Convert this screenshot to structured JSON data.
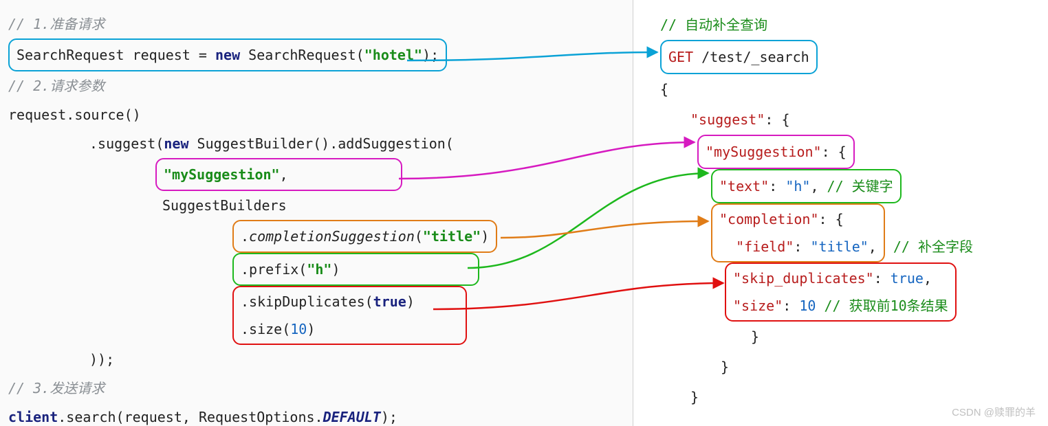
{
  "left": {
    "c1": "// 1.准备请求",
    "l1_a": "SearchRequest request = ",
    "l1_new": "new",
    "l1_b": " SearchRequest(",
    "l1_hotel": "\"hotel\"",
    "l1_c": ");",
    "c2": "// 2.请求参数",
    "l2": "request.source()",
    "l3_a": ".suggest(",
    "l3_new": "new",
    "l3_b": " SuggestBuilder().addSuggestion(",
    "l4_box": "\"mySuggestion\"",
    "l4_comma": ",",
    "l5": "SuggestBuilders",
    "l6_a": ".",
    "l6_it": "completionSuggestion",
    "l6_b": "(",
    "l6_title": "\"title\"",
    "l6_c": ")",
    "l7_a": ".prefix(",
    "l7_h": "\"h\"",
    "l7_b": ")",
    "l8_a": ".skipDuplicates(",
    "l8_true": "true",
    "l8_b": ")",
    "l9_a": ".size(",
    "l9_10": "10",
    "l9_b": ")",
    "l10": "));",
    "c3": "// 3.发送请求",
    "l11_a": "client",
    "l11_b": ".search(request, RequestOptions.",
    "l11_def": "DEFAULT",
    "l11_c": ");"
  },
  "right": {
    "c1": "// 自动补全查询",
    "get": "GET",
    "path": " /test/_search",
    "ob": "{",
    "s_label": "\"suggest\"",
    "colon_ob": ": {",
    "ms_label": "\"mySuggestion\"",
    "text_k": "\"text\"",
    "text_v": "\"h\"",
    "text_comma": ",",
    "text_c": " // 关键字",
    "comp_k": "\"completion\"",
    "field_k": "\"field\"",
    "field_v": "\"title\"",
    "field_comma": ",",
    "comp_c": " // 补全字段",
    "skip_k": "\"skip_duplicates\"",
    "skip_v": "true",
    "skip_comma": ",",
    "size_k": "\"size\"",
    "size_v": "10",
    "size_c": " // 获取前10条结果",
    "cb": "}"
  },
  "watermark": "CSDN @赎罪的羊"
}
